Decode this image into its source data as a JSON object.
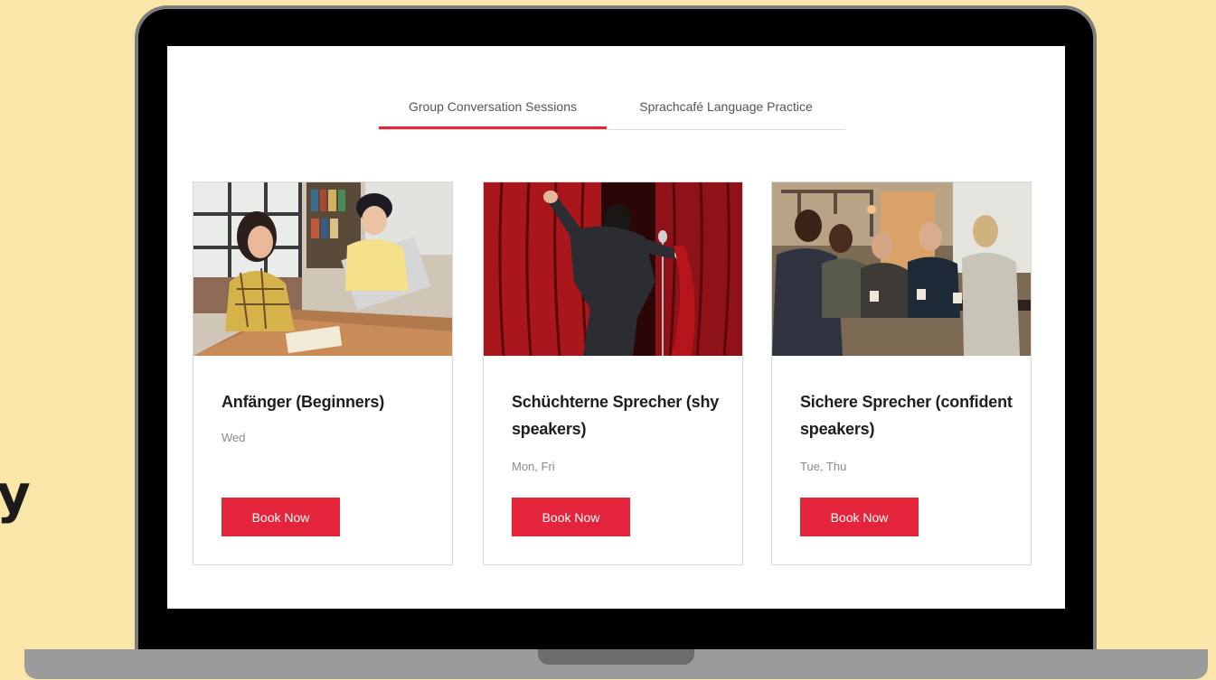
{
  "side_fragment": "y",
  "tabs": [
    {
      "label": "Group Conversation Sessions",
      "active": true
    },
    {
      "label": "Sprachcafé Language Practice",
      "active": false
    }
  ],
  "cards": [
    {
      "title": "Anfänger (Beginners)",
      "days": "Wed",
      "button_label": "Book Now"
    },
    {
      "title": "Schüchterne Sprecher (shy speakers)",
      "days": "Mon, Fri",
      "button_label": "Book Now"
    },
    {
      "title": "Sichere Sprecher (confident speakers)",
      "days": "Tue, Thu",
      "button_label": "Book Now"
    }
  ],
  "colors": {
    "background": "#fae6a9",
    "accent": "#e3243b",
    "laptop_frame": "#000000",
    "laptop_base": "#9b9b9b"
  }
}
